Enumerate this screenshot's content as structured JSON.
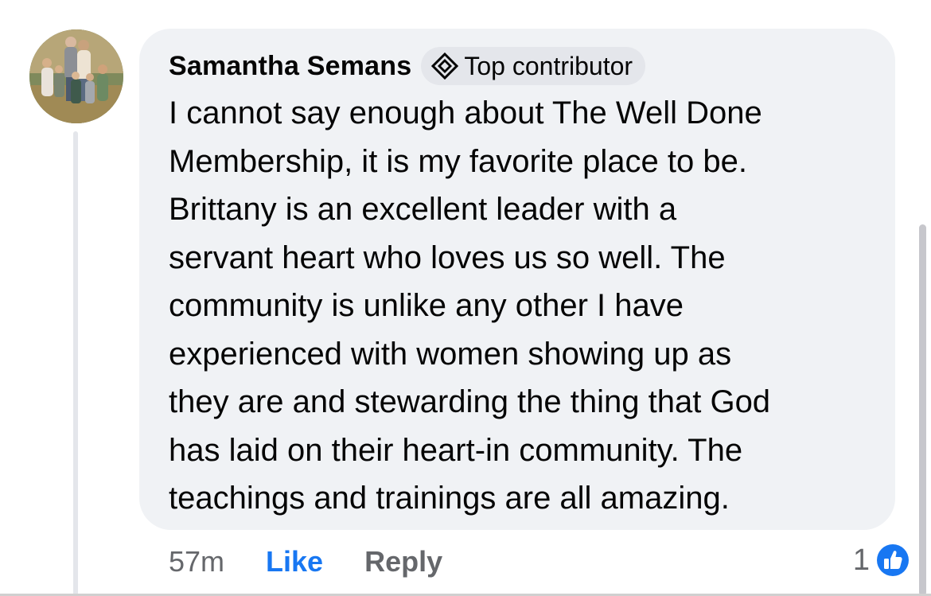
{
  "comment": {
    "author": "Samantha Semans",
    "badge": {
      "label": "Top contributor",
      "icon": "diamond-badge-icon"
    },
    "lines": [
      "I cannot say enough about The Well Done",
      "Membership, it is my favorite place to be.",
      "Brittany is an excellent leader with a",
      "servant heart who loves us so well. The",
      "community is unlike any other I have",
      "experienced with women showing up as",
      "they are and stewarding the thing that God",
      "has laid on their heart-in community. The",
      "teachings and trainings are all amazing."
    ],
    "timestamp": "57m",
    "like_label": "Like",
    "reply_label": "Reply",
    "reaction_count": "1",
    "reaction_icon": "like-thumb-icon"
  },
  "colors": {
    "bubble": "#f0f2f5",
    "text": "#050505",
    "muted": "#65676b",
    "accent": "#1877f2"
  }
}
